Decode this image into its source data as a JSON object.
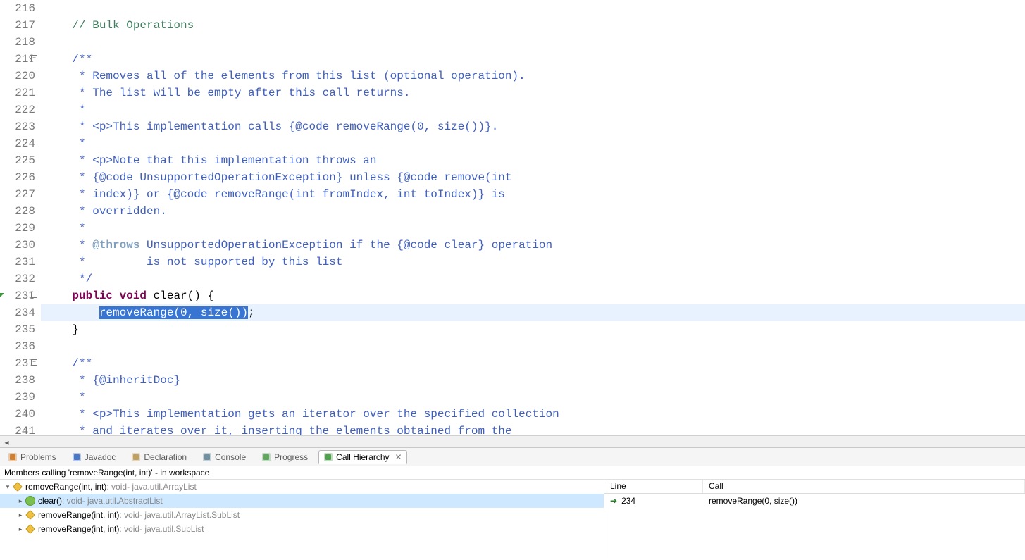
{
  "editor": {
    "first_line": 216,
    "current_line": 234,
    "selection_text": "removeRange(0, size())",
    "lines": [
      {
        "n": 216,
        "segs": [
          {
            "t": "",
            "c": "plain"
          }
        ]
      },
      {
        "n": 217,
        "segs": [
          {
            "t": "    ",
            "c": "plain"
          },
          {
            "t": "// Bulk Operations",
            "c": "comment"
          }
        ]
      },
      {
        "n": 218,
        "segs": [
          {
            "t": "",
            "c": "plain"
          }
        ]
      },
      {
        "n": 219,
        "fold": true,
        "segs": [
          {
            "t": "    ",
            "c": "plain"
          },
          {
            "t": "/**",
            "c": "javadoc"
          }
        ]
      },
      {
        "n": 220,
        "segs": [
          {
            "t": "     * Removes all of the elements from this list (optional operation).",
            "c": "javadoc"
          }
        ]
      },
      {
        "n": 221,
        "segs": [
          {
            "t": "     * The list will be empty after this call returns.",
            "c": "javadoc"
          }
        ]
      },
      {
        "n": 222,
        "segs": [
          {
            "t": "     *",
            "c": "javadoc"
          }
        ]
      },
      {
        "n": 223,
        "segs": [
          {
            "t": "     * <p>This implementation calls {@code removeRange(0, size())}.",
            "c": "javadoc"
          }
        ]
      },
      {
        "n": 224,
        "segs": [
          {
            "t": "     *",
            "c": "javadoc"
          }
        ]
      },
      {
        "n": 225,
        "segs": [
          {
            "t": "     * <p>Note that this implementation throws an",
            "c": "javadoc"
          }
        ]
      },
      {
        "n": 226,
        "segs": [
          {
            "t": "     * {@code UnsupportedOperationException} unless {@code remove(int",
            "c": "javadoc"
          }
        ]
      },
      {
        "n": 227,
        "segs": [
          {
            "t": "     * index)} or {@code removeRange(int fromIndex, int toIndex)} is",
            "c": "javadoc"
          }
        ]
      },
      {
        "n": 228,
        "segs": [
          {
            "t": "     * overridden.",
            "c": "javadoc"
          }
        ]
      },
      {
        "n": 229,
        "segs": [
          {
            "t": "     *",
            "c": "javadoc"
          }
        ]
      },
      {
        "n": 230,
        "segs": [
          {
            "t": "     * ",
            "c": "javadoc"
          },
          {
            "t": "@throws",
            "c": "jd-tag"
          },
          {
            "t": " UnsupportedOperationException if the {@code clear} operation",
            "c": "javadoc"
          }
        ]
      },
      {
        "n": 231,
        "segs": [
          {
            "t": "     *         is not supported by this list",
            "c": "javadoc"
          }
        ]
      },
      {
        "n": 232,
        "segs": [
          {
            "t": "     */",
            "c": "javadoc"
          }
        ]
      },
      {
        "n": 233,
        "fold": true,
        "anno": "green-tri",
        "segs": [
          {
            "t": "    ",
            "c": "plain"
          },
          {
            "t": "public",
            "c": "keyword"
          },
          {
            "t": " ",
            "c": "plain"
          },
          {
            "t": "void",
            "c": "keyword"
          },
          {
            "t": " clear() {",
            "c": "plain"
          }
        ]
      },
      {
        "n": 234,
        "current": true,
        "segs": [
          {
            "t": "        ",
            "c": "plain"
          },
          {
            "t": "removeRange(0, size())",
            "c": "plain",
            "sel": true
          },
          {
            "t": ";",
            "c": "plain"
          }
        ]
      },
      {
        "n": 235,
        "segs": [
          {
            "t": "    }",
            "c": "plain"
          }
        ]
      },
      {
        "n": 236,
        "segs": [
          {
            "t": "",
            "c": "plain"
          }
        ]
      },
      {
        "n": 237,
        "fold": true,
        "segs": [
          {
            "t": "    ",
            "c": "plain"
          },
          {
            "t": "/**",
            "c": "javadoc"
          }
        ]
      },
      {
        "n": 238,
        "segs": [
          {
            "t": "     * {@inheritDoc}",
            "c": "javadoc"
          }
        ]
      },
      {
        "n": 239,
        "segs": [
          {
            "t": "     *",
            "c": "javadoc"
          }
        ]
      },
      {
        "n": 240,
        "segs": [
          {
            "t": "     * <p>This implementation gets an iterator over the specified collection",
            "c": "javadoc"
          }
        ]
      },
      {
        "n": 241,
        "segs": [
          {
            "t": "     * and iterates over it, inserting the elements obtained from the",
            "c": "javadoc"
          }
        ]
      }
    ]
  },
  "tabs": [
    {
      "id": "problems",
      "label": "Problems",
      "icon": "problems",
      "active": false
    },
    {
      "id": "javadoc",
      "label": "Javadoc",
      "icon": "javadoc",
      "active": false
    },
    {
      "id": "declaration",
      "label": "Declaration",
      "icon": "declaration",
      "active": false
    },
    {
      "id": "console",
      "label": "Console",
      "icon": "console",
      "active": false
    },
    {
      "id": "progress",
      "label": "Progress",
      "icon": "progress",
      "active": false
    },
    {
      "id": "callhierarchy",
      "label": "Call Hierarchy",
      "icon": "callhierarchy",
      "active": true,
      "closable": true
    }
  ],
  "panel_description": "Members calling 'removeRange(int, int)' - in workspace",
  "tree": [
    {
      "depth": 0,
      "expand": "open",
      "icon": "protected",
      "name": "removeRange(int, int)",
      "ret": " : void",
      "pkg": " - java.util.ArrayList",
      "selected": false
    },
    {
      "depth": 1,
      "expand": "closed",
      "icon": "public",
      "name": "clear()",
      "ret": " : void",
      "pkg": " - java.util.AbstractList",
      "selected": true
    },
    {
      "depth": 1,
      "expand": "closed",
      "icon": "protected",
      "name": "removeRange(int, int)",
      "ret": " : void",
      "pkg": " - java.util.ArrayList.SubList",
      "selected": false
    },
    {
      "depth": 1,
      "expand": "closed",
      "icon": "protected",
      "name": "removeRange(int, int)",
      "ret": " : void",
      "pkg": " - java.util.SubList",
      "selected": false
    }
  ],
  "calltable": {
    "headers": {
      "line": "Line",
      "call": "Call"
    },
    "rows": [
      {
        "line": "234",
        "call": "removeRange(0, size())"
      }
    ]
  }
}
